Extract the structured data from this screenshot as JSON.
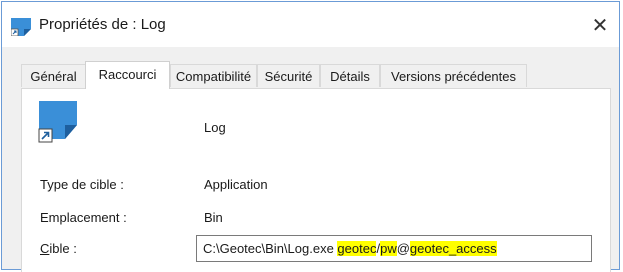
{
  "window": {
    "title": "Propriétés de : Log",
    "close_symbol": "✕"
  },
  "tabs": [
    {
      "label": "Général",
      "active": false
    },
    {
      "label": "Raccourci",
      "active": true
    },
    {
      "label": "Compatibilité",
      "active": false
    },
    {
      "label": "Sécurité",
      "active": false
    },
    {
      "label": "Détails",
      "active": false
    },
    {
      "label": "Versions précédentes",
      "active": false
    }
  ],
  "shortcut": {
    "name": "Log",
    "icon": "application-shortcut-icon"
  },
  "fields": {
    "type_label": "Type de cible :",
    "type_value": "Application",
    "location_label": "Emplacement :",
    "location_value": "Bin",
    "target_label_first": "C",
    "target_label_rest": "ible :",
    "target_value": {
      "part1": "C:\\Geotec\\Bin\\Log.exe ",
      "part2": "geotec",
      "part3": "/",
      "part4": "pw",
      "part5": "@",
      "part6": "geotec_access",
      "highlight_color": "#ffff00"
    }
  },
  "colors": {
    "accent": "#3a8fd8",
    "frame_border": "#6b9bd6"
  }
}
